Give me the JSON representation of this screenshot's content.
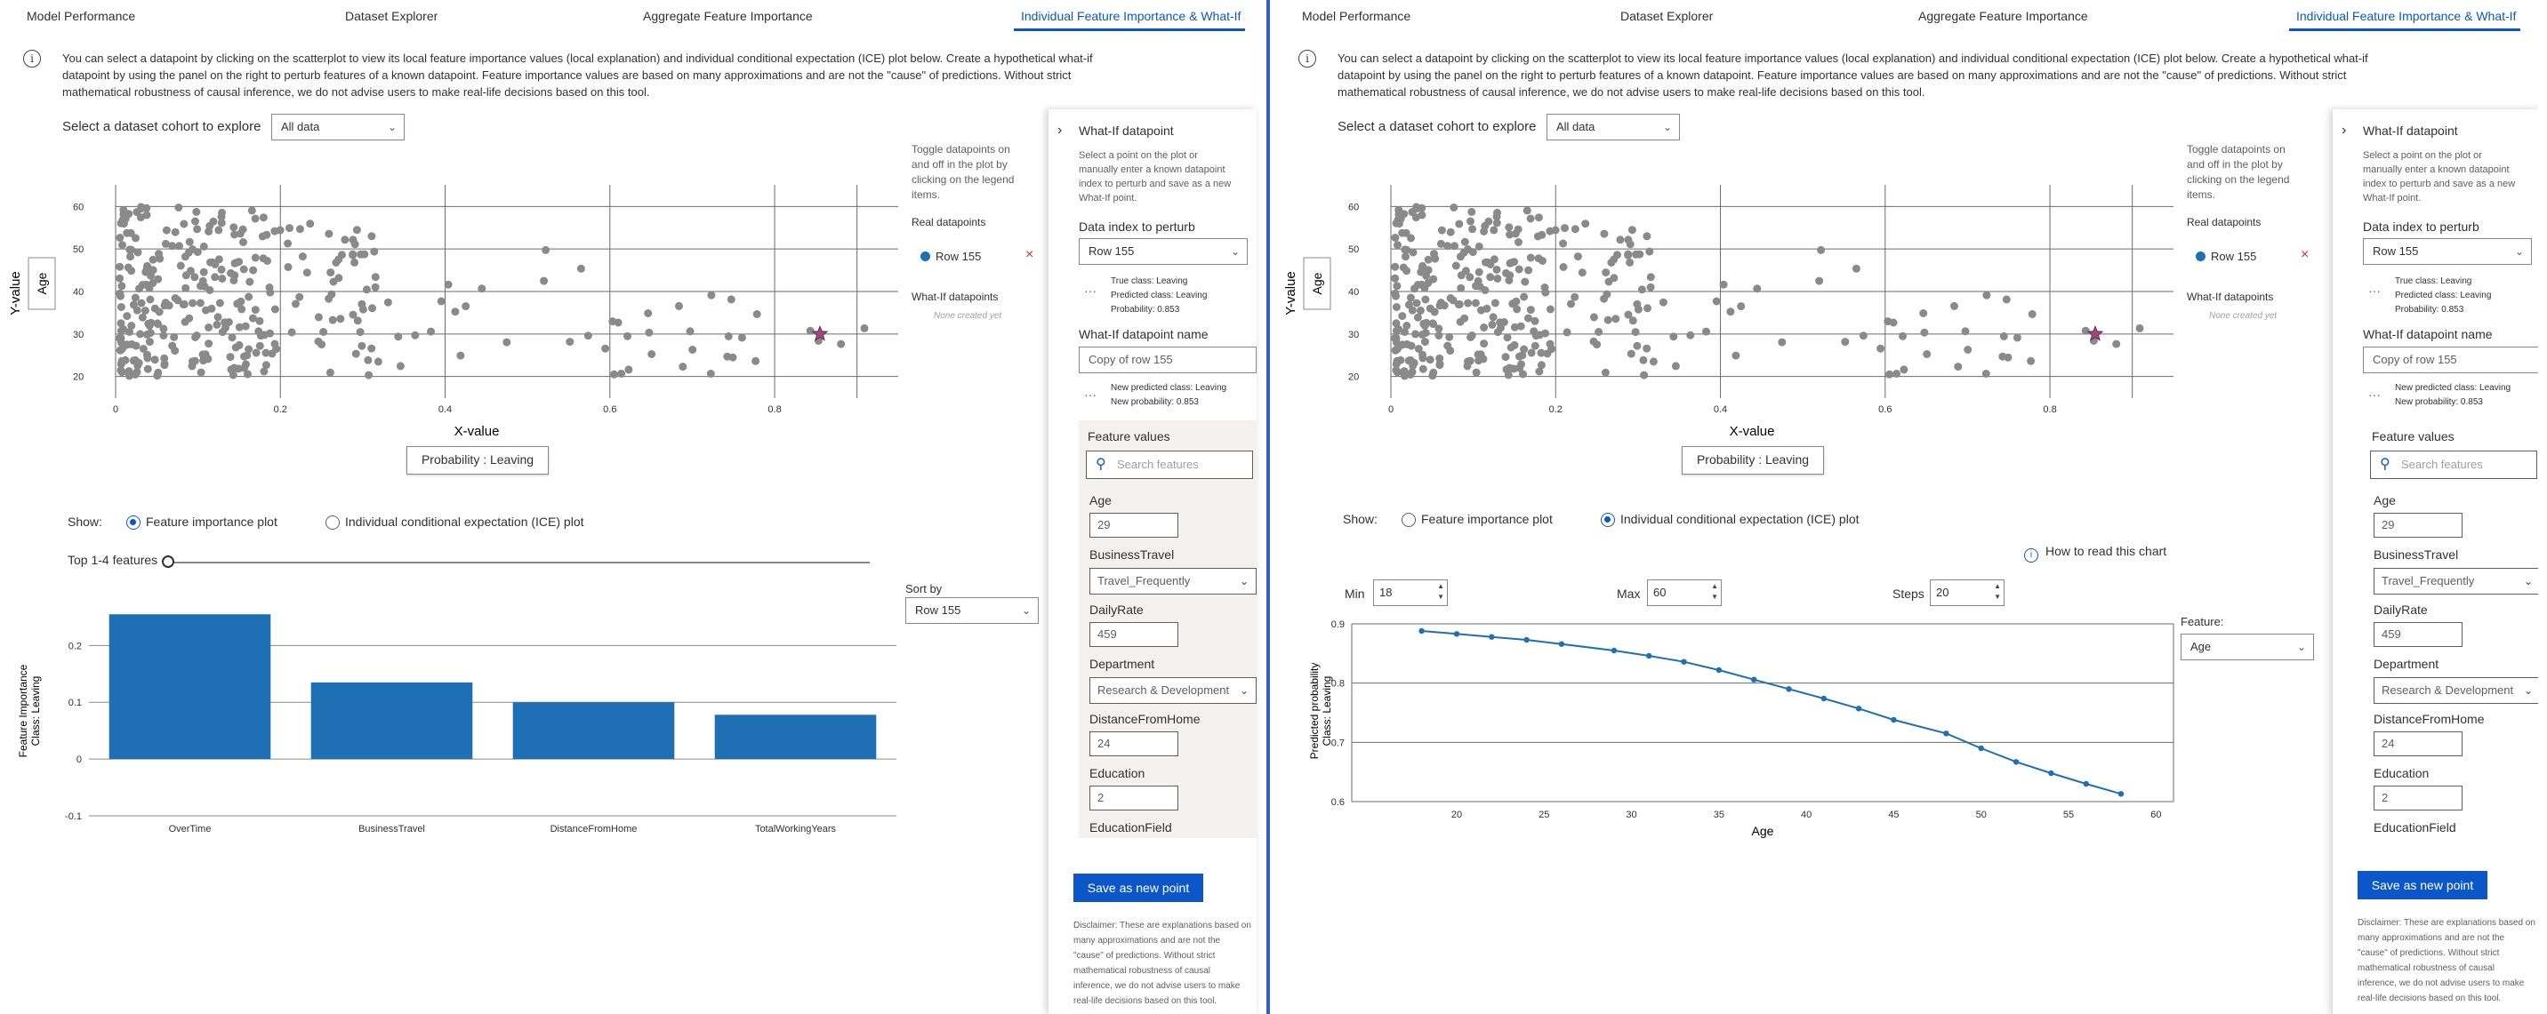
{
  "tabs": [
    "Model Performance",
    "Dataset Explorer",
    "Aggregate Feature Importance",
    "Individual Feature Importance & What-If"
  ],
  "info_text": "You can select a datapoint by clicking on the scatterplot to view its local feature importance values (local explanation) and individual conditional expectation (ICE) plot below. Create a hypothetical what-if datapoint by using the panel on the right to perturb features of a known datapoint. Feature importance values are based on many approximations and are not the \"cause\" of predictions. Without strict mathematical robustness of causal inference, we do not advise users to make real-life decisions based on this tool.",
  "cohort": {
    "label": "Select a dataset cohort to explore",
    "value": "All data"
  },
  "scatter": {
    "y_axis_title": "Y-value",
    "y_axis_button": "Age",
    "x_axis_title": "X-value",
    "x_axis_button": "Probability : Leaving",
    "x_ticks": [
      "0",
      "0.2",
      "0.4",
      "0.6",
      "0.8"
    ],
    "y_ticks": [
      "20",
      "30",
      "40",
      "50",
      "60"
    ]
  },
  "legend": {
    "hint": "Toggle datapoints on and off in the plot by clicking on the legend items.",
    "real_title": "Real datapoints",
    "real_item": "Row 155",
    "remove_icon": "×",
    "whatif_title": "What-If datapoints",
    "whatif_none": "None created yet"
  },
  "show": {
    "label": "Show:",
    "option_fi": "Feature importance plot",
    "option_ice": "Individual conditional expectation (ICE) plot"
  },
  "fi": {
    "top_label": "Top 1-4 features",
    "sort_label": "Sort by",
    "sort_value": "Row 155",
    "y_label_1": "Feature Importance",
    "y_label_2": "Class: Leaving",
    "y_ticks": [
      "0.2",
      "0.1",
      "0",
      "-0.1"
    ]
  },
  "ice": {
    "how_to_read": "How to read this chart",
    "min_label": "Min",
    "min_value": "18",
    "max_label": "Max",
    "max_value": "60",
    "steps_label": "Steps",
    "steps_value": "20",
    "feature_label": "Feature:",
    "feature_value": "Age",
    "y_label_1": "Predicted probability",
    "y_label_2": "Class: Leaving",
    "x_label": "Age",
    "x_ticks": [
      "20",
      "25",
      "30",
      "35",
      "40",
      "45",
      "50",
      "55",
      "60"
    ],
    "y_ticks": [
      "0.9",
      "0.8",
      "0.7",
      "0.6"
    ]
  },
  "panel": {
    "title": "What-If datapoint",
    "description": "Select a point on the plot or manually enter a known datapoint index to perturb and save as a new What-If point.",
    "index_label": "Data index to perturb",
    "index_value": "Row 155",
    "true_class": "True class: Leaving",
    "pred_class": "Predicted class: Leaving",
    "probability": "Probability: 0.853",
    "name_label": "What-If datapoint name",
    "name_value": "Copy of row 155",
    "new_pred_class": "New predicted class: Leaving",
    "new_probability": "New probability: 0.853",
    "feature_values": "Feature values",
    "search_placeholder": "Search features",
    "features": {
      "age_label": "Age",
      "age_value": "29",
      "travel_label": "BusinessTravel",
      "travel_value": "Travel_Frequently",
      "rate_label": "DailyRate",
      "rate_value": "459",
      "dept_label": "Department",
      "dept_value": "Research & Development",
      "dist_label": "DistanceFromHome",
      "dist_value": "24",
      "edu_label": "Education",
      "edu_value": "2",
      "field_label": "EducationField"
    },
    "save_button": "Save as new point",
    "disclaimer": "Disclaimer: These are explanations based on many approximations and are not the \"cause\" of predictions. Without strict mathematical robustness of causal inference, we do not advise users to make real-life decisions based on this tool."
  },
  "colors": {
    "accent": "#0b57c9",
    "bar": "#1f6fb4",
    "scatter": "#8a8a8a",
    "whatif_star": "#9c4a7c"
  },
  "chart_data": [
    {
      "type": "scatter",
      "xlabel": "X-value",
      "ylabel": "Y-value",
      "xlim": [
        0,
        0.95
      ],
      "ylim": [
        17,
        63
      ],
      "grid": true,
      "series": [
        {
          "name": "Row 155",
          "points": [
            [
              0.855,
              30
            ]
          ]
        }
      ]
    },
    {
      "type": "bar",
      "categories": [
        "OverTime",
        "BusinessTravel",
        "DistanceFromHome",
        "TotalWorkingYears"
      ],
      "values": [
        0.255,
        0.135,
        0.1,
        0.078
      ],
      "ylabel": "Feature Importance Class: Leaving",
      "ylim": [
        -0.1,
        0.26
      ]
    },
    {
      "type": "line",
      "xlabel": "Age",
      "ylabel": "Predicted probability Class: Leaving",
      "xlim": [
        14,
        61
      ],
      "ylim": [
        0.6,
        0.9
      ],
      "x": [
        18,
        20,
        22,
        24,
        26,
        29,
        31,
        33,
        35,
        37,
        39,
        41,
        43,
        45,
        48,
        50,
        52,
        54,
        56,
        58
      ],
      "series": [
        {
          "values": [
            0.888,
            0.883,
            0.878,
            0.873,
            0.866,
            0.855,
            0.846,
            0.836,
            0.822,
            0.806,
            0.79,
            0.774,
            0.757,
            0.738,
            0.715,
            0.69,
            0.667,
            0.648,
            0.63,
            0.613
          ]
        }
      ]
    }
  ]
}
